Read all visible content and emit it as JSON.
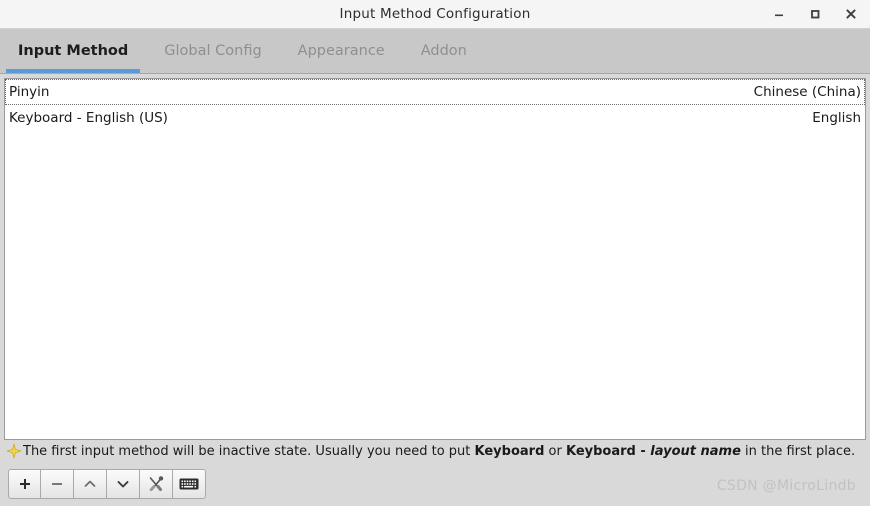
{
  "window": {
    "title": "Input Method Configuration",
    "controls": [
      {
        "name": "minimize",
        "label": "–"
      },
      {
        "name": "maximize",
        "label": "□"
      },
      {
        "name": "close",
        "label": "×"
      }
    ]
  },
  "tabs": [
    {
      "label": "Input Method",
      "active": true
    },
    {
      "label": "Global Config",
      "active": false
    },
    {
      "label": "Appearance",
      "active": false
    },
    {
      "label": "Addon",
      "active": false
    }
  ],
  "list": {
    "rows": [
      {
        "name": "Pinyin",
        "language": "Chinese (China)",
        "focused": true
      },
      {
        "name": "Keyboard - English (US)",
        "language": "English",
        "focused": false
      }
    ]
  },
  "hint": {
    "icon": "sparkle-star-icon",
    "part1": "The first input method will be inactive state. Usually you need to put ",
    "bold1": "Keyboard",
    "mid": " or ",
    "bold2": "Keyboard - ",
    "italic": "layout name",
    "part2": " in the first place."
  },
  "toolbar": {
    "buttons": [
      {
        "name": "add-input-method-button",
        "icon": "plus-icon",
        "title": "Add"
      },
      {
        "name": "remove-input-method-button",
        "icon": "minus-icon",
        "title": "Remove"
      },
      {
        "name": "move-up-button",
        "icon": "chevron-up-icon",
        "title": "Move Up"
      },
      {
        "name": "move-down-button",
        "icon": "chevron-down-icon",
        "title": "Move Down"
      },
      {
        "name": "configure-button",
        "icon": "tools-icon",
        "title": "Configure"
      },
      {
        "name": "keyboard-layout-button",
        "icon": "keyboard-icon",
        "title": "Keyboard Layout"
      }
    ]
  },
  "watermark": {
    "text": "CSDN @MicroLindb"
  },
  "colors": {
    "titlebar": "#f5f5f5",
    "tabbar": "#c8c8c8",
    "accent": "#5b9bd5",
    "panel": "#ffffff",
    "chrome": "#d9d9d9",
    "sparkle": "#e8c94a"
  }
}
